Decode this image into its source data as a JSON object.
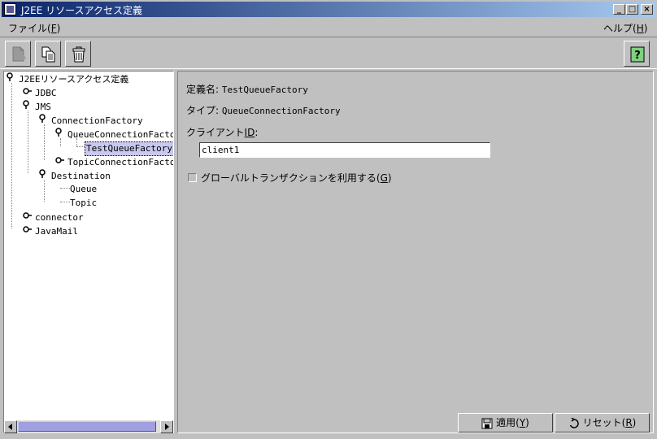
{
  "window": {
    "title": "J2EE リソースアクセス定義"
  },
  "menu": {
    "file": {
      "label": "ファイル(",
      "mnemonic": "F",
      "suffix": ")"
    },
    "help": {
      "label": "ヘルプ(",
      "mnemonic": "H",
      "suffix": ")"
    }
  },
  "toolbar": {
    "buttons": [
      "new-doc-icon",
      "copy-icon",
      "trash-icon"
    ],
    "help": "help-icon"
  },
  "tree": {
    "root": "J2EEリソースアクセス定義",
    "jdbc": "JDBC",
    "jms": "JMS",
    "connection_factory": "ConnectionFactory",
    "queue_cf": "QueueConnectionFactor",
    "test_queue_factory": "TestQueueFactory",
    "topic_cf": "TopicConnectionFactor",
    "destination": "Destination",
    "queue": "Queue",
    "topic": "Topic",
    "connector": "connector",
    "javamail": "JavaMail"
  },
  "detail": {
    "name_label": "定義名:",
    "name_value": "TestQueueFactory",
    "type_label": "タイプ:",
    "type_value": "QueueConnectionFactory",
    "client_id_label": "クライアント",
    "client_id_mn": "ID",
    "client_id_colon": ":",
    "client_id_value": "client1",
    "global_tx_label": "グローバルトランザクションを利用する(",
    "global_tx_mn": "G",
    "global_tx_suffix": ")",
    "global_tx_checked": false
  },
  "buttons": {
    "apply": {
      "label": "適用(",
      "mnemonic": "Y",
      "suffix": ")"
    },
    "reset": {
      "label": "リセット(",
      "mnemonic": "R",
      "suffix": ")"
    }
  }
}
